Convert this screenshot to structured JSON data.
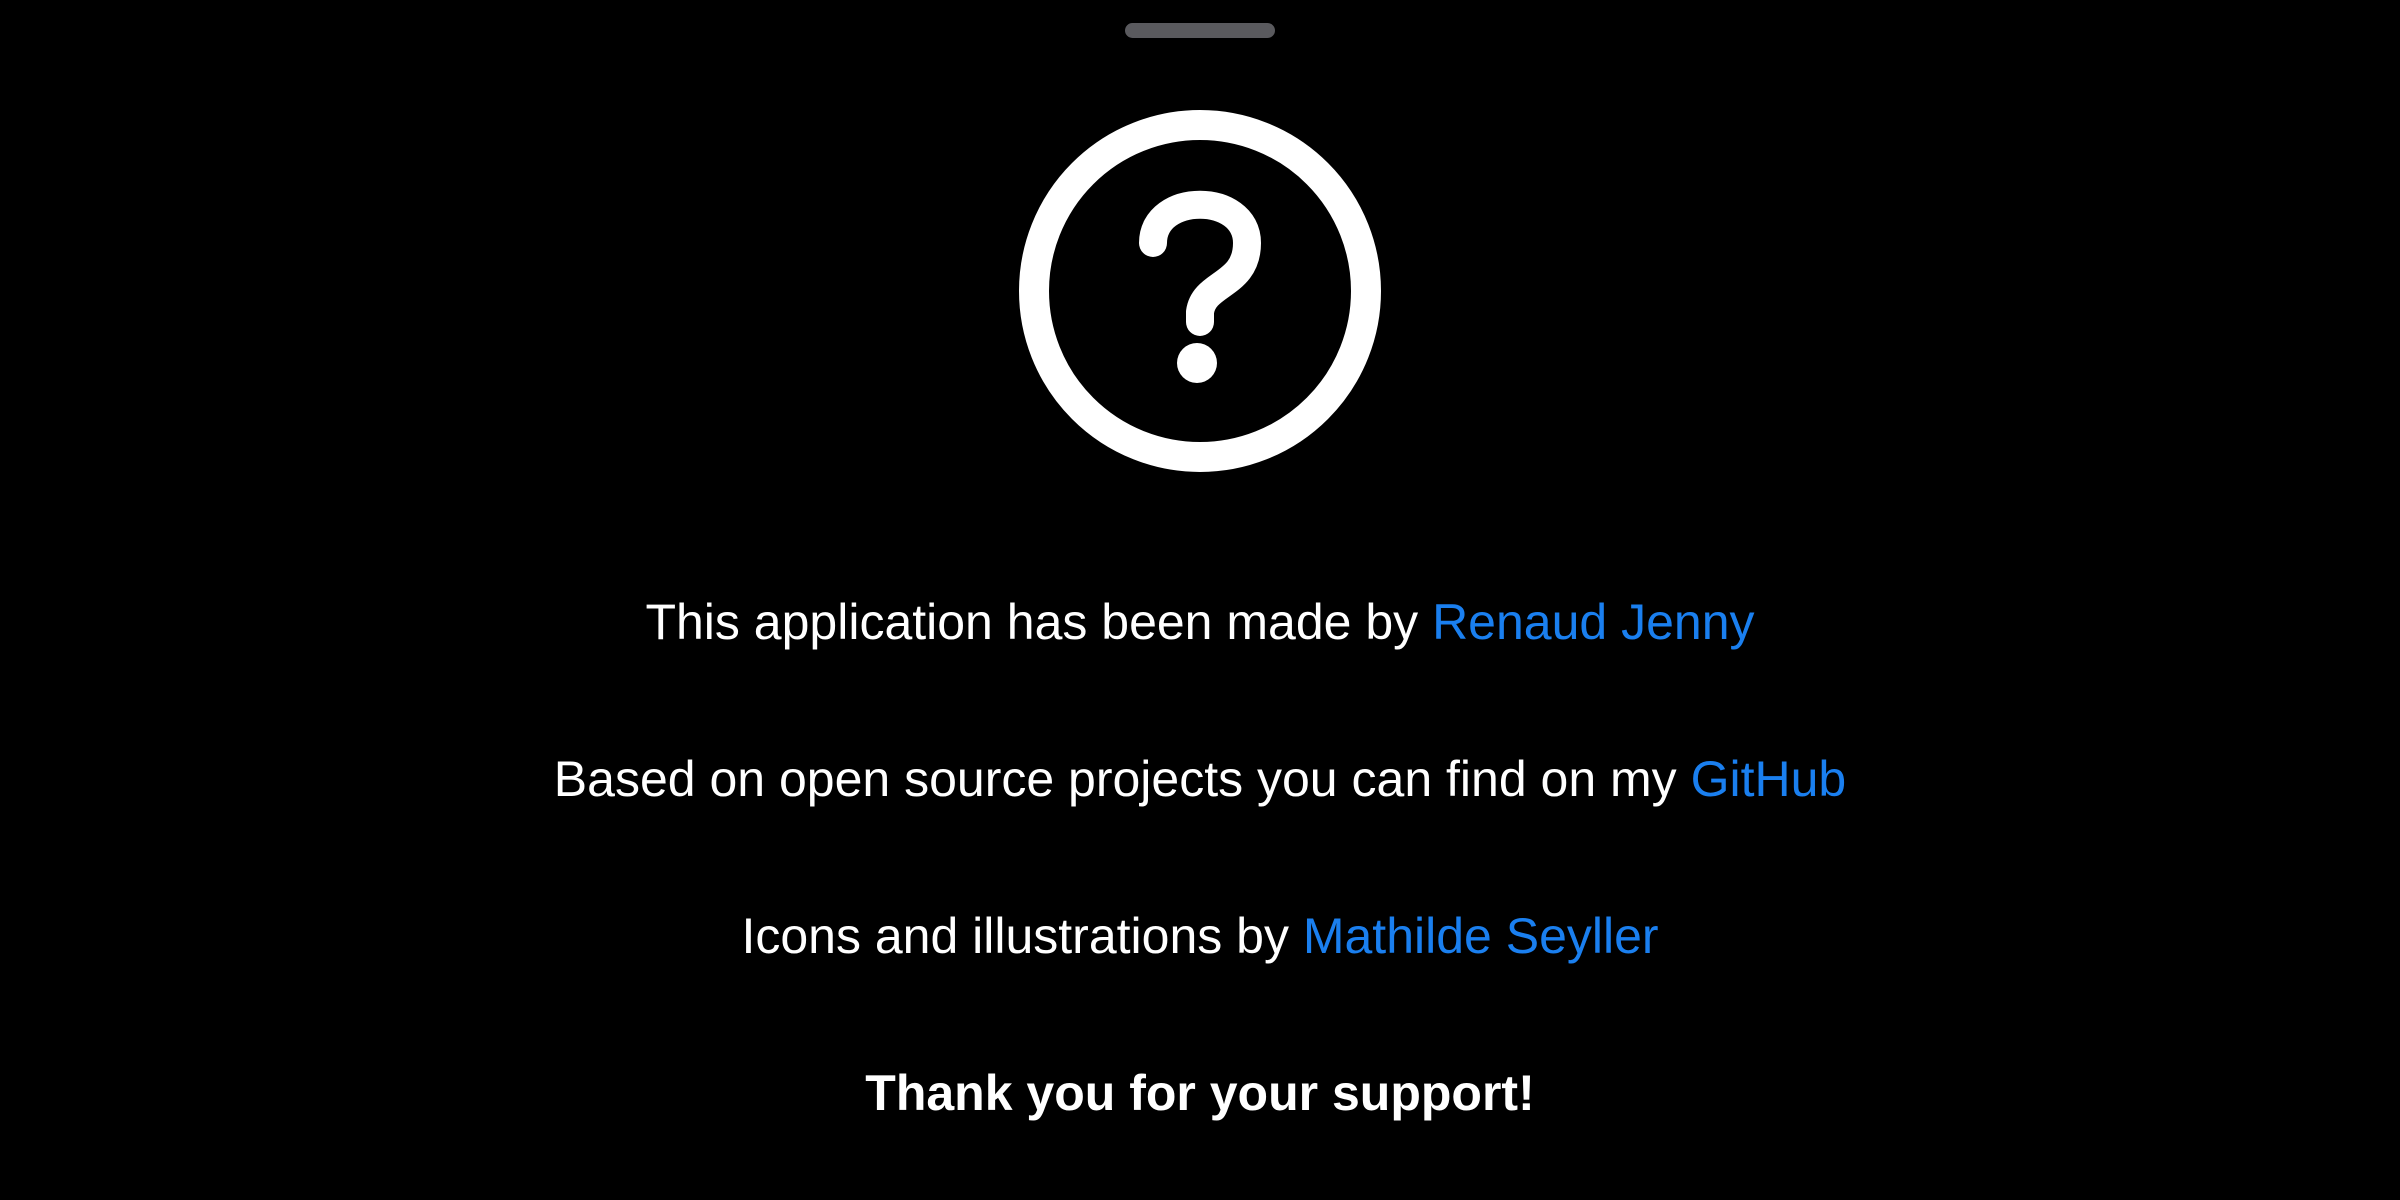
{
  "sheet": {
    "grabber_icon": "drag-handle",
    "hero_icon": "question-mark-circle"
  },
  "about": {
    "made_by_prefix": "This application has been made by ",
    "made_by_link": "Renaud Jenny",
    "open_source_prefix": "Based on open source projects you can find on my ",
    "open_source_link": "GitHub",
    "illustrations_prefix": "Icons and illustrations by ",
    "illustrations_link": "Mathilde Seyller",
    "thanks": "Thank you for your support!"
  },
  "colors": {
    "background": "#000000",
    "text": "#ffffff",
    "link": "#1a7fef",
    "grabber": "#5a5a5e"
  }
}
